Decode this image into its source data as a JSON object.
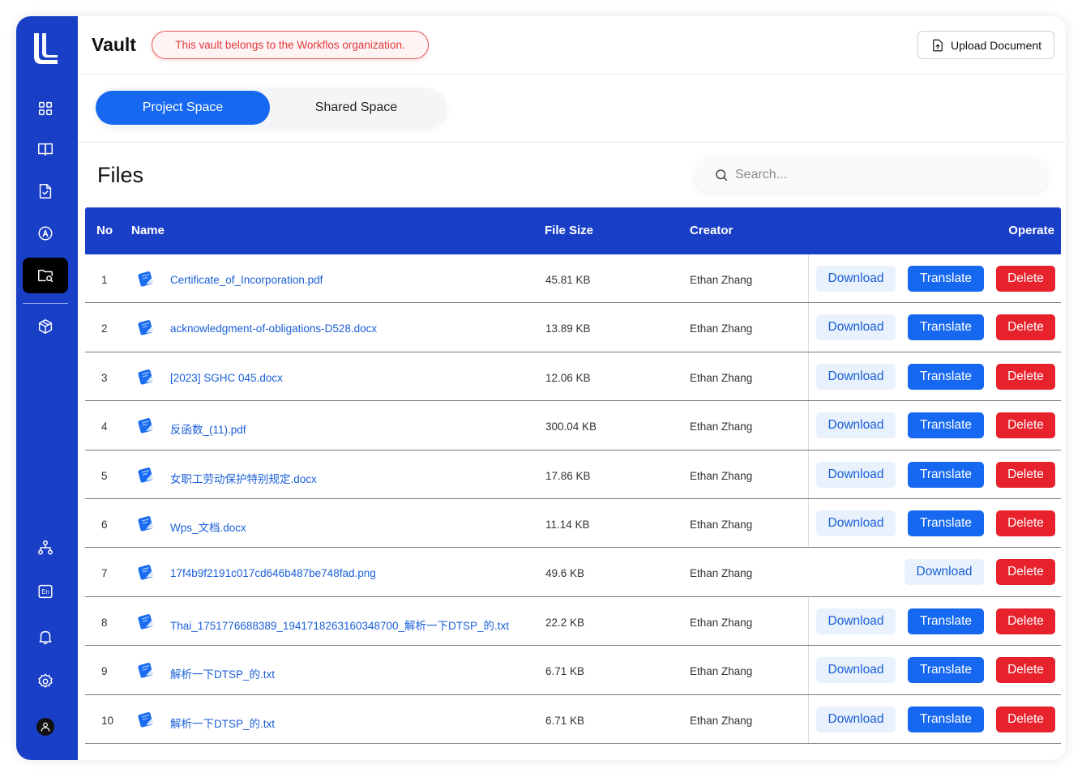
{
  "sidebar": {
    "logo_icon": "logo-l-icon",
    "items": [
      {
        "name": "dashboard",
        "icon": "grid-icon"
      },
      {
        "name": "library",
        "icon": "book-icon"
      },
      {
        "name": "document",
        "icon": "document-icon"
      },
      {
        "name": "translate",
        "icon": "translate-a-icon"
      },
      {
        "name": "vault",
        "icon": "folder-search-icon",
        "active": true
      },
      {
        "name": "packages",
        "icon": "cube-icon"
      },
      {
        "name": "organization",
        "icon": "org-chart-icon"
      },
      {
        "name": "language",
        "icon": "en-icon",
        "label": "En"
      },
      {
        "name": "notifications",
        "icon": "bell-icon"
      },
      {
        "name": "settings",
        "icon": "gear-icon"
      },
      {
        "name": "profile",
        "icon": "user-icon"
      }
    ],
    "colors": {
      "background": "#1a3fc7",
      "active": "#000000"
    }
  },
  "header": {
    "title": "Vault",
    "org_badge": "This vault belongs to the Workflos organization.",
    "upload_label": "Upload Document"
  },
  "tabs": [
    {
      "label": "Project Space",
      "active": true
    },
    {
      "label": "Shared Space",
      "active": false
    }
  ],
  "files": {
    "title": "Files",
    "search_placeholder": "Search..."
  },
  "table": {
    "columns": {
      "no": "No",
      "name": "Name",
      "size": "File Size",
      "creator": "Creator",
      "operate": "Operate"
    },
    "button_labels": {
      "download": "Download",
      "translate": "Translate",
      "delete": "Delete"
    },
    "rows": [
      {
        "no": "1",
        "name": "Certificate_of_Incorporation.pdf",
        "size": "45.81 KB",
        "creator": "Ethan Zhang",
        "translatable": true
      },
      {
        "no": "2",
        "name": "acknowledgment-of-obligations-D528.docx",
        "size": "13.89 KB",
        "creator": "Ethan Zhang",
        "translatable": true
      },
      {
        "no": "3",
        "name": "[2023] SGHC 045.docx",
        "size": "12.06 KB",
        "creator": "Ethan Zhang",
        "translatable": true
      },
      {
        "no": "4",
        "name": "反函数_(11).pdf",
        "size": "300.04 KB",
        "creator": "Ethan Zhang",
        "translatable": true
      },
      {
        "no": "5",
        "name": "女职工劳动保护特别规定.docx",
        "size": "17.86 KB",
        "creator": "Ethan Zhang",
        "translatable": true
      },
      {
        "no": "6",
        "name": "Wps_文档.docx",
        "size": "11.14 KB",
        "creator": "Ethan Zhang",
        "translatable": true
      },
      {
        "no": "7",
        "name": "17f4b9f2191c017cd646b487be748fad.png",
        "size": "49.6 KB",
        "creator": "Ethan Zhang",
        "translatable": false
      },
      {
        "no": "8",
        "name": "Thai_1751776688389_1941718263160348700_解析一下DTSP_的.txt",
        "size": "22.2 KB",
        "creator": "Ethan Zhang",
        "translatable": true
      },
      {
        "no": "9",
        "name": "解析一下DTSP_的.txt",
        "size": "6.71 KB",
        "creator": "Ethan Zhang",
        "translatable": true
      },
      {
        "no": "10",
        "name": "解析一下DTSP_的.txt",
        "size": "6.71 KB",
        "creator": "Ethan Zhang",
        "translatable": true
      }
    ]
  },
  "colors": {
    "primary": "#1668f0",
    "header_blue": "#1a3fc7",
    "danger": "#e8222c",
    "link": "#1a5fd8",
    "download_bg": "#e8f1fc"
  }
}
